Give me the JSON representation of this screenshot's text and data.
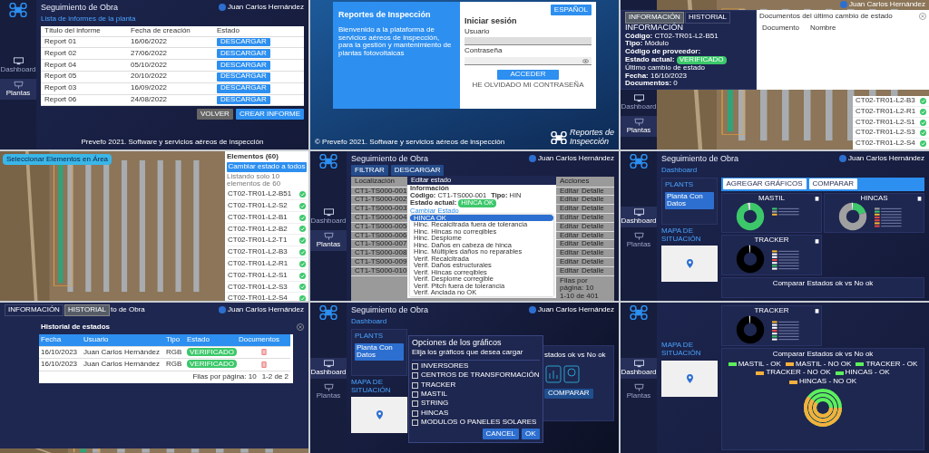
{
  "panels": [
    {
      "kind": "report_list",
      "app_title": "Seguimiento de Obra",
      "user": "Juan Carlos Hernández",
      "nav": [
        {
          "label": "Dashboard",
          "selected": false
        },
        {
          "label": "Plantas",
          "selected": true
        }
      ],
      "heading": "Lista de informes de la planta",
      "columns": [
        "Título del informe",
        "Fecha de creación",
        "Estado"
      ],
      "rows": [
        {
          "title": "Report 01",
          "date": "16/06/2022",
          "action": "DESCARGAR"
        },
        {
          "title": "Report 02",
          "date": "27/06/2022",
          "action": "DESCARGAR"
        },
        {
          "title": "Report 04",
          "date": "05/10/2022",
          "action": "DESCARGAR"
        },
        {
          "title": "Report 05",
          "date": "20/10/2022",
          "action": "DESCARGAR"
        },
        {
          "title": "Report 03",
          "date": "16/09/2022",
          "action": "DESCARGAR"
        },
        {
          "title": "Report 06",
          "date": "24/08/2022",
          "action": "DESCARGAR"
        }
      ],
      "buttons": [
        {
          "label": "VOLVER",
          "kind": "secondary"
        },
        {
          "label": "CREAR INFORME",
          "kind": "primary"
        }
      ],
      "footer": "Prevefo 2021. Software y servicios aéreos de inspección"
    },
    {
      "kind": "login",
      "welcome_title": "Reportes de Inspección",
      "welcome_text": "Bienvenido a la plataforma de servicios aéreos de inspección, para la gestión y mantenimiento de plantas fotovoltaicas",
      "language": "ESPAÑOL",
      "form_title": "Iniciar sesión",
      "user_label": "Usuario",
      "password_label": "Contraseña",
      "submit": "ACCEDER",
      "forgot": "HE OLVIDADO MI CONTRASEÑA",
      "footer": "© Prevefo 2021. Software y servicios aéreos de inspección",
      "brand": [
        "Reportes de",
        "Inspección"
      ]
    },
    {
      "kind": "element_info",
      "user": "Juan Carlos Hernández",
      "nav": [
        {
          "label": "Dashboard",
          "selected": false
        },
        {
          "label": "Plantas",
          "selected": true
        }
      ],
      "tabs": [
        {
          "label": "INFORMACIÓN",
          "selected": true
        },
        {
          "label": "HISTORIAL",
          "selected": false
        }
      ],
      "info_title": "INFORMACIÓN",
      "fields": [
        {
          "label": "Código:",
          "value": "CT02-TR01-L2-B51"
        },
        {
          "label": "Tipo:",
          "value": "Módulo"
        },
        {
          "label": "Código de proveedor:"
        }
      ],
      "state_label": "Estado actual:",
      "state": "VERIFICADO",
      "last_change": "Último cambio de estado",
      "change_fields": [
        {
          "label": "Fecha:",
          "value": "16/10/2023"
        },
        {
          "label": "Documentos:",
          "value": "0"
        }
      ],
      "docs_title": "Documentos del último cambio de estado",
      "docs_columns": [
        "Documento",
        "Nombre"
      ],
      "elements": [
        "CT02-TR01-L2-B3",
        "CT02-TR01-L2-R1",
        "CT02-TR01-L2-S1",
        "CT02-TR01-L2-S3",
        "CT02-TR01-L2-S4"
      ]
    },
    {
      "kind": "map_select",
      "select_button": "Seleccionar Elementos en Área",
      "list_title": "Elementos (60)",
      "change_all": "Cambiar estado a todos",
      "note": "Listando solo 10 elementos de 60",
      "elements": [
        "CT02-TR01-L2-B51",
        "CT02-TR01-L2-S2",
        "CT02-TR01-L2-B1",
        "CT02-TR01-L2-B2",
        "CT02-TR01-L2-T1",
        "CT02-TR01-L2-B3",
        "CT02-TR01-L2-R1",
        "CT02-TR01-L2-S1",
        "CT02-TR01-L2-S3",
        "CT02-TR01-L2-S4"
      ]
    },
    {
      "kind": "state_editor",
      "app_title": "Seguimiento de Obra",
      "user": "Juan Carlos Hernández",
      "nav": [
        {
          "label": "Dashboard",
          "selected": false
        },
        {
          "label": "Plantas",
          "selected": true
        }
      ],
      "toolbar": [
        "FILTRAR",
        "DESCARGAR"
      ],
      "columns": [
        "Localización",
        "Acciones"
      ],
      "rows": [
        {
          "code": "CT1-TS000-001",
          "actions": [
            "Editar",
            "Detalle"
          ]
        },
        {
          "code": "CT1-TS000-002",
          "actions": [
            "Editar",
            "Detalle"
          ]
        },
        {
          "code": "CT1-TS000-003",
          "actions": [
            "Editar",
            "Detalle"
          ]
        },
        {
          "code": "CT1-TS000-004",
          "actions": [
            "Editar",
            "Detalle"
          ]
        },
        {
          "code": "CT1-TS000-005",
          "actions": [
            "Editar",
            "Detalle"
          ]
        },
        {
          "code": "CT1-TS000-006",
          "actions": [
            "Editar",
            "Detalle"
          ]
        },
        {
          "code": "CT1-TS000-007",
          "actions": [
            "Editar",
            "Detalle"
          ]
        },
        {
          "code": "CT1-TS000-008",
          "actions": [
            "Editar",
            "Detalle"
          ]
        },
        {
          "code": "CT1-TS000-009",
          "actions": [
            "Editar",
            "Detalle"
          ]
        },
        {
          "code": "CT1-TS000-010",
          "actions": [
            "Editar",
            "Detalle"
          ]
        }
      ],
      "rows_per_page": "Filas por página: 10",
      "page_range": "1-10 de 401",
      "dialog_title": "Editar estado",
      "info_title": "Información",
      "info": [
        {
          "label": "Código:",
          "value": "CT1-TS000-001"
        },
        {
          "label": "Tipo:",
          "value": "HIN"
        }
      ],
      "state_label": "Estado actual:",
      "state": "HINCA OK",
      "change_title": "Cambiar Estado",
      "options": [
        {
          "label": "HINCA OK",
          "selected": true
        },
        {
          "label": "Hinc. Recalcitrada fuera de tolerancia",
          "selected": false
        },
        {
          "label": "Hinc. Hincas no corregibles",
          "selected": false
        },
        {
          "label": "Hinc. Desplome",
          "selected": false
        },
        {
          "label": "Hinc. Daños en cabeza de hinca",
          "selected": false
        },
        {
          "label": "Hinc. Múltiples daños no reparables",
          "selected": false
        },
        {
          "label": "Verif. Recalcitrada",
          "selected": false
        },
        {
          "label": "Verif. Daños estructurales",
          "selected": false
        },
        {
          "label": "Verif. Hincas corregibles",
          "selected": false
        },
        {
          "label": "Verif. Desplome corregible",
          "selected": false
        },
        {
          "label": "Verif. Pitch fuera de tolerancia",
          "selected": false
        },
        {
          "label": "Verif. Anclada no OK",
          "selected": false
        }
      ]
    },
    {
      "kind": "dashboard",
      "app_title": "Seguimiento de Obra",
      "user": "Juan Carlos Hernández",
      "nav": [
        {
          "label": "Dashboard",
          "selected": true
        },
        {
          "label": "Plantas",
          "selected": false
        }
      ],
      "section": "Dashboard",
      "plants_label": "PLANTS",
      "plant_item": "Planta Con Datos",
      "map_label": "MAPA DE SITUACIÓN",
      "toolbar": [
        "AGREGAR GRÁFICOS",
        "COMPARAR"
      ],
      "charts": [
        {
          "title": "MASTIL"
        },
        {
          "title": "HINCAS"
        },
        {
          "title": "TRACKER"
        }
      ],
      "compare_title": "Comparar Estados ok vs No ok"
    },
    {
      "kind": "history",
      "user": "Juan Carlos Hernández",
      "tabs": [
        {
          "label": "INFORMACIÓN",
          "selected": false
        },
        {
          "label": "HISTORIAL",
          "selected": true
        }
      ],
      "app_title": "to de Obra",
      "title": "Historial de estados",
      "columns": [
        "Fecha",
        "Usuario",
        "Tipo",
        "Estado",
        "Documentos"
      ],
      "rows": [
        {
          "date": "16/10/2023",
          "user": "Juan Carlos Hernández",
          "type": "RGB",
          "state": "VERIFICADO"
        },
        {
          "date": "16/10/2023",
          "user": "Juan Carlos Hernández",
          "type": "RGB",
          "state": "VERIFICADO"
        }
      ],
      "rows_per_page": "Filas por página: 10",
      "page_range": "1-2 de 2"
    },
    {
      "kind": "chart_options",
      "app_title": "Seguimiento de Obra",
      "user": "Juan Carlos Hernández",
      "nav": [
        {
          "label": "Dashboard",
          "selected": true
        },
        {
          "label": "Plantas",
          "selected": false
        }
      ],
      "section": "Dashboard",
      "plants_label": "PLANTS",
      "plant_item": "Planta Con Datos",
      "map_label": "MAPA DE SITUACIÓN",
      "compare_title": "stados ok vs No ok",
      "compare_button": "COMPARAR",
      "dialog_title": "Opciones de los gráficos",
      "dialog_text": "Elija los gráficos que desea cargar",
      "options": [
        {
          "label": "INVERSORES",
          "checked": false
        },
        {
          "label": "CENTROS DE TRANSFORMACIÓN",
          "checked": false
        },
        {
          "label": "TRACKER",
          "checked": false
        },
        {
          "label": "MASTIL",
          "checked": false
        },
        {
          "label": "STRING",
          "checked": false
        },
        {
          "label": "HINCAS",
          "checked": false
        },
        {
          "label": "MODULOS O PANELES SOLARES",
          "checked": false
        }
      ],
      "buttons": [
        "CANCEL",
        "OK"
      ]
    },
    {
      "kind": "compare",
      "nav": [
        {
          "label": "Dashboard",
          "selected": true
        },
        {
          "label": "Plantas",
          "selected": false
        }
      ],
      "map_label": "MAPA DE SITUACIÓN",
      "chart_title": "TRACKER",
      "compare_title": "Comparar Estados ok vs No ok",
      "compare_legend": [
        {
          "label": "MASTIL - OK",
          "color": "#5cf05c"
        },
        {
          "label": "MASTIL - NO OK",
          "color": "#f5b03c"
        },
        {
          "label": "TRACKER - OK",
          "color": "#5cf05c"
        },
        {
          "label": "TRACKER - NO OK",
          "color": "#f5b03c"
        },
        {
          "label": "HINCAS - OK",
          "color": "#5cf05c"
        },
        {
          "label": "HINCAS - NO OK",
          "color": "#f5b03c"
        }
      ]
    }
  ]
}
